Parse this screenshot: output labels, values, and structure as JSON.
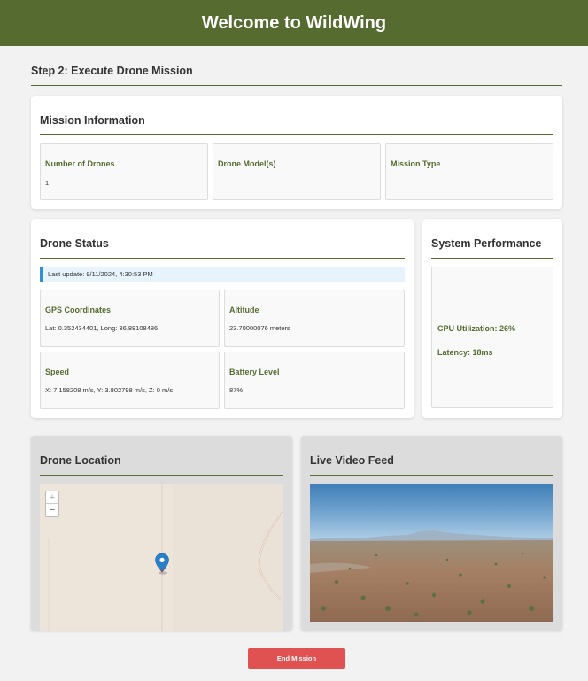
{
  "header": {
    "title": "Welcome to WildWing"
  },
  "step": {
    "title": "Step 2: Execute Drone Mission"
  },
  "mission_info": {
    "title": "Mission Information",
    "fields": [
      {
        "label": "Number of Drones",
        "value": "1"
      },
      {
        "label": "Drone Model(s)",
        "value": ""
      },
      {
        "label": "Mission Type",
        "value": ""
      }
    ]
  },
  "drone_status": {
    "title": "Drone Status",
    "last_update": "Last update: 9/11/2024, 4:30:53 PM",
    "fields": [
      {
        "label": "GPS Coordinates",
        "value": "Lat: 0.352434401, Long: 36.88108486"
      },
      {
        "label": "Altitude",
        "value": "23.70000076 meters"
      },
      {
        "label": "Speed",
        "value": "X: 7.158208 m/s, Y: 3.802798 m/s, Z: 0 m/s"
      },
      {
        "label": "Battery Level",
        "value": "87%"
      }
    ]
  },
  "system_performance": {
    "title": "System Performance",
    "cpu": "CPU Utilization: 26%",
    "latency": "Latency: 18ms"
  },
  "drone_location": {
    "title": "Drone Location",
    "zoom_in": "+",
    "zoom_out": "−",
    "marker_icon": "map-marker-icon"
  },
  "video_feed": {
    "title": "Live Video Feed"
  },
  "actions": {
    "end_mission": "End Mission"
  },
  "colors": {
    "header_bg": "#556b2f",
    "accent": "#556b2f",
    "danger": "#e05252",
    "info_border": "#2f8fd0"
  }
}
